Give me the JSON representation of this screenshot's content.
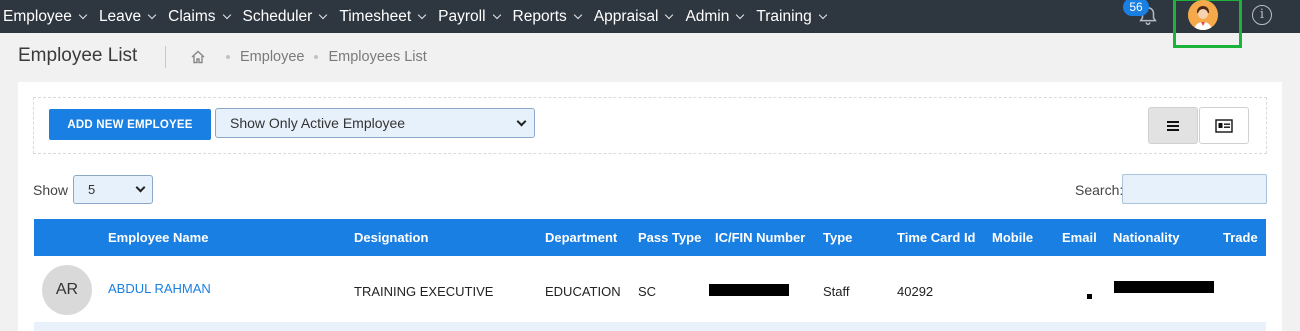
{
  "nav": {
    "menu": [
      "Employee",
      "Leave",
      "Claims",
      "Scheduler",
      "Timesheet",
      "Payroll",
      "Reports",
      "Appraisal",
      "Admin",
      "Training"
    ],
    "notification_count": "56"
  },
  "header": {
    "title": "Employee List",
    "breadcrumb": [
      "Employee",
      "Employees List"
    ]
  },
  "toolbar": {
    "add_label": "ADD NEW EMPLOYEE",
    "filter_value": "Show Only Active Employee"
  },
  "table_controls": {
    "show_label": "Show",
    "show_value": "5",
    "search_label": "Search:"
  },
  "table": {
    "columns": [
      "Employee Name",
      "Designation",
      "Department",
      "Pass Type",
      "IC/FIN Number",
      "Type",
      "Time Card Id",
      "Mobile",
      "Email",
      "Nationality",
      "Trade"
    ],
    "rows": [
      {
        "initials": "AR",
        "name": "ABDUL RAHMAN",
        "designation": "TRAINING EXECUTIVE",
        "department": "EDUCATION",
        "pass_type": "SC",
        "type": "Staff",
        "time_card_id": "40292"
      }
    ]
  },
  "colors": {
    "navbar": "#2e3640",
    "accent": "#1a7fe2",
    "highlight": "#1cb33a"
  }
}
